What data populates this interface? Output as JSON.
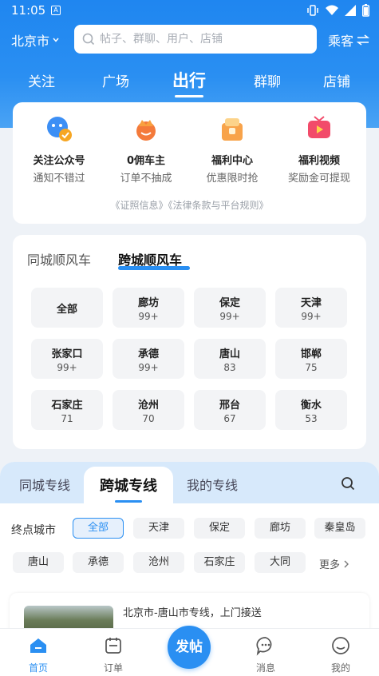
{
  "status": {
    "time": "11:05",
    "a_badge": "A"
  },
  "topbar": {
    "city": "北京市",
    "search_placeholder": "帖子、群聊、用户、店铺",
    "role": "乘客"
  },
  "nav_tabs": [
    {
      "label": "关注"
    },
    {
      "label": "广场"
    },
    {
      "label": "出行",
      "active": true
    },
    {
      "label": "群聊"
    },
    {
      "label": "店铺"
    }
  ],
  "services": [
    {
      "title": "关注公众号",
      "subtitle": "通知不错过",
      "icon": "official-account-icon"
    },
    {
      "title": "0佣车主",
      "subtitle": "订单不抽成",
      "icon": "crown-driver-icon"
    },
    {
      "title": "福利中心",
      "subtitle": "优惠限时抢",
      "icon": "gift-bag-icon"
    },
    {
      "title": "福利视频",
      "subtitle": "奖励金可提现",
      "icon": "tv-video-icon"
    }
  ],
  "legal": "《证照信息》《法律条款与平台规则》",
  "ride": {
    "tabs": [
      {
        "label": "同城顺风车"
      },
      {
        "label": "跨城顺风车",
        "active": true
      }
    ],
    "cities": [
      {
        "name": "全部",
        "count": ""
      },
      {
        "name": "廊坊",
        "count": "99+"
      },
      {
        "name": "保定",
        "count": "99+"
      },
      {
        "name": "天津",
        "count": "99+"
      },
      {
        "name": "张家口",
        "count": "99+"
      },
      {
        "name": "承德",
        "count": "99+"
      },
      {
        "name": "唐山",
        "count": "83"
      },
      {
        "name": "邯郸",
        "count": "75"
      },
      {
        "name": "石家庄",
        "count": "71"
      },
      {
        "name": "沧州",
        "count": "70"
      },
      {
        "name": "邢台",
        "count": "67"
      },
      {
        "name": "衡水",
        "count": "53"
      }
    ]
  },
  "route": {
    "tabs": [
      {
        "label": "同城专线"
      },
      {
        "label": "跨城专线",
        "active": true
      },
      {
        "label": "我的专线"
      }
    ],
    "filter_label": "终点城市",
    "chips_row1": [
      "全部",
      "天津",
      "保定",
      "廊坊",
      "秦皇岛"
    ],
    "chips_row2": [
      "唐山",
      "承德",
      "沧州",
      "石家庄",
      "大同"
    ],
    "more": "更多",
    "listing_title": "北京市-唐山市专线，上门接送"
  },
  "bottom_nav": {
    "home": "首页",
    "orders": "订单",
    "post": "发帖",
    "messages": "消息",
    "me": "我的"
  },
  "colors": {
    "accent": "#2a8ff2",
    "header": "#1f86f0"
  }
}
